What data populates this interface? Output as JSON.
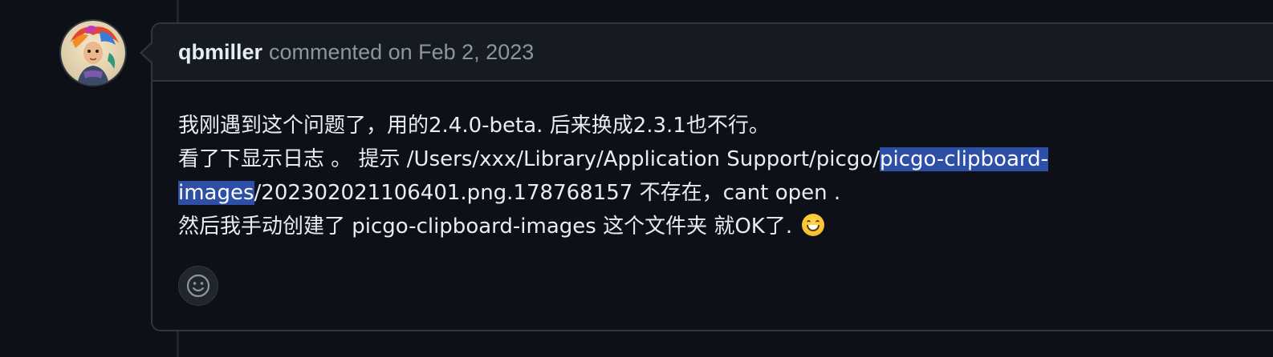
{
  "comment": {
    "author": "qbmiller",
    "meta": "commented on Feb 2, 2023",
    "line1": "我刚遇到这个问题了，用的2.4.0-beta. 后来换成2.3.1也不行。",
    "line2_prefix": "看了下显示日志 。 提示 /Users/xxx/Library/Application Support/picgo/",
    "line2_selected": "picgo-clipboard-",
    "line3_selected": "images",
    "line3_suffix": "/202302021106401.png.178768157 不存在，cant open .",
    "line4": "然后我手动创建了 picgo-clipboard-images 这个文件夹 就OK了. ",
    "emoji": "grinning-face",
    "reaction_icon": "smiley-icon"
  },
  "colors": {
    "background": "#0d1117",
    "header_background": "#161b22",
    "border": "#30363d",
    "text": "#e6edf3",
    "muted_text": "#8d96a0",
    "selection": "#2d4fa5"
  }
}
